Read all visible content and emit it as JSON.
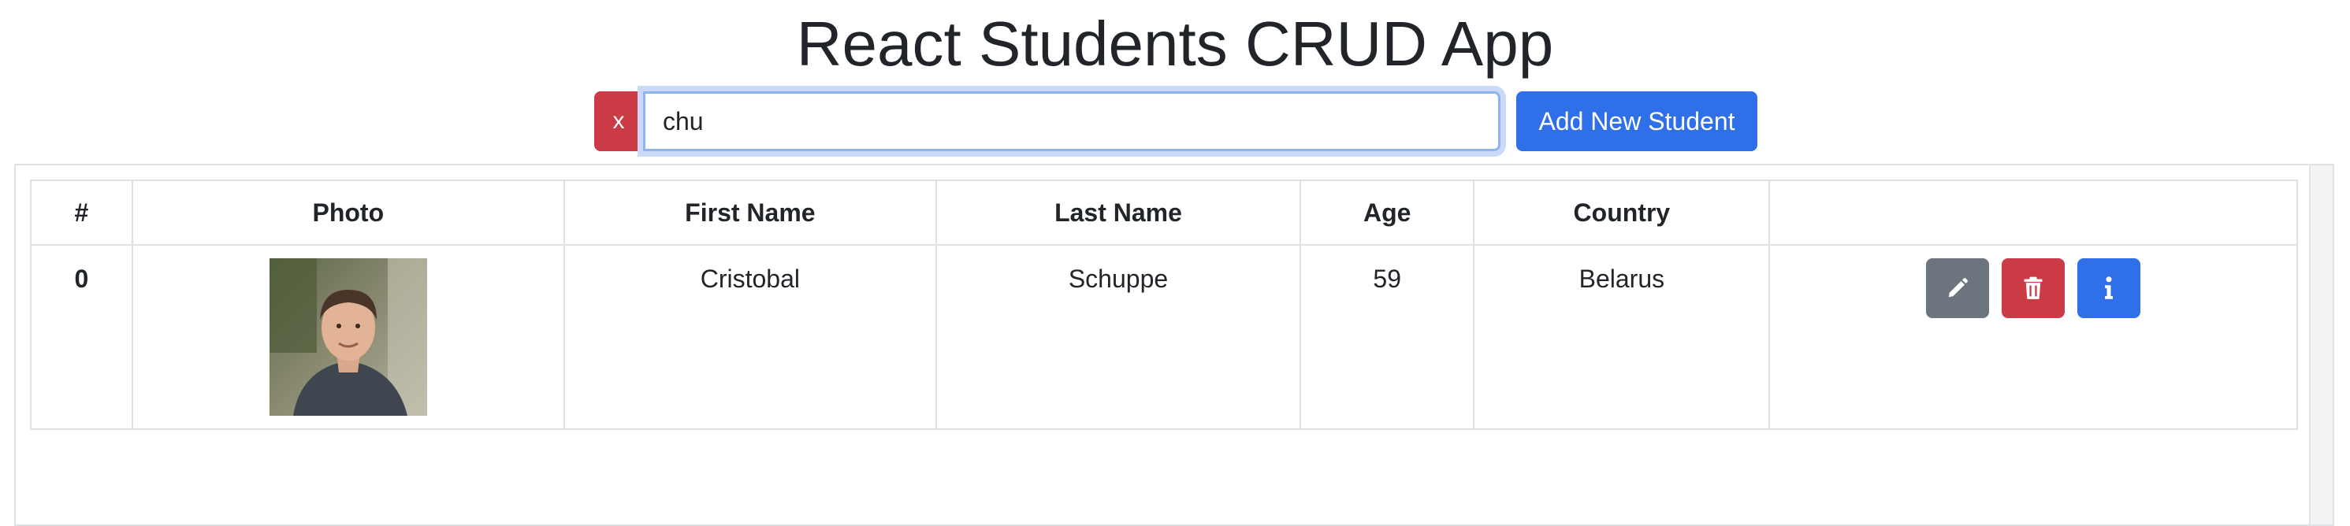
{
  "header": {
    "title": "React Students CRUD App"
  },
  "search": {
    "clear_label": "x",
    "value": "chu"
  },
  "toolbar": {
    "add_label": "Add New Student"
  },
  "table": {
    "columns": [
      "#",
      "Photo",
      "First Name",
      "Last Name",
      "Age",
      "Country",
      ""
    ],
    "rows": [
      {
        "index": "0",
        "photo_icon": "student-photo",
        "first_name": "Cristobal",
        "last_name": "Schuppe",
        "age": "59",
        "country": "Belarus",
        "actions": [
          "pencil-icon",
          "trash-icon",
          "info-icon"
        ]
      }
    ]
  },
  "colors": {
    "primary": "#2f6fe8",
    "danger": "#ca3b45",
    "secondary": "#6c757d"
  }
}
